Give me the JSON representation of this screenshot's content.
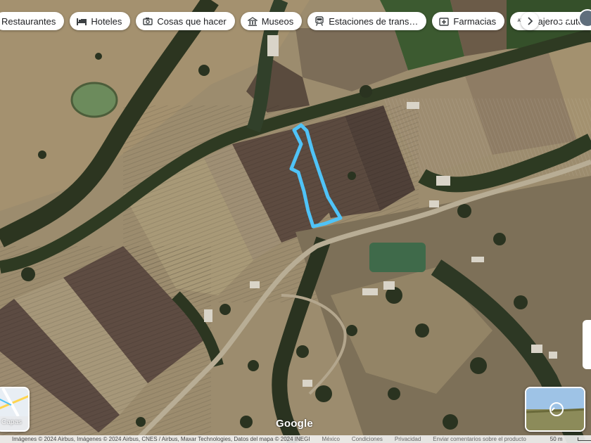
{
  "chips": [
    {
      "label": "Restaurantes",
      "icon": "restaurant-icon"
    },
    {
      "label": "Hoteles",
      "icon": "bed-icon"
    },
    {
      "label": "Cosas que hacer",
      "icon": "camera-icon"
    },
    {
      "label": "Museos",
      "icon": "museum-icon"
    },
    {
      "label": "Estaciones de trans…",
      "icon": "train-icon"
    },
    {
      "label": "Farmacias",
      "icon": "pharmacy-icon"
    },
    {
      "label": "Cajeros autom",
      "icon": "atm-icon",
      "badge": "ATM"
    }
  ],
  "chip_next_icon": "chevron-right-icon",
  "apps_icon": "grid-icon",
  "layers": {
    "label": "Capas",
    "icon": "layers-icon"
  },
  "logo": "Google",
  "attribution": {
    "credits": "Imágenes © 2024 Airbus, Imágenes © 2024 Airbus, CNES / Airbus, Maxar Technologies, Datos del mapa © 2024 INEGI",
    "links": [
      "México",
      "Condiciones",
      "Privacidad",
      "Enviar comentarios sobre el producto"
    ],
    "scale": "50 m"
  },
  "route": {
    "color": "#4fc3f7",
    "name": "drawn-boundary"
  },
  "colors": {
    "field_dark": "#5c4a3f",
    "field_light": "#8a7a63",
    "dry_land": "#a39374",
    "vegetation": "#2f3a1f",
    "road": "#b7ab92",
    "pond": "#6c8b5c",
    "crop_green": "#3c5a30"
  }
}
